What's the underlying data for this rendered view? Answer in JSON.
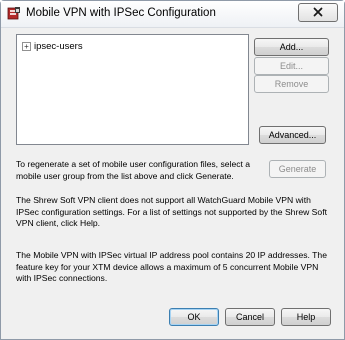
{
  "window": {
    "title": "Mobile VPN with IPSec Configuration",
    "close_label": "✕"
  },
  "tree": {
    "items": [
      {
        "label": "ipsec-users",
        "expander": "+"
      }
    ]
  },
  "buttons": {
    "add": "Add...",
    "edit": "Edit...",
    "remove": "Remove",
    "advanced": "Advanced...",
    "generate": "Generate",
    "ok": "OK",
    "cancel": "Cancel",
    "help": "Help"
  },
  "text": {
    "regenerate": "To regenerate a set of mobile user configuration files, select a mobile user group from the list above and click Generate.",
    "shrew": "The Shrew Soft VPN client does not support all WatchGuard Mobile VPN with IPSec configuration settings. For a list of settings not supported by the Shrew Soft VPN client, click Help.",
    "pool": "The Mobile VPN with IPSec virtual IP address pool contains 20 IP addresses. The feature key for your XTM device allows a maximum of 5 concurrent Mobile VPN with IPSec connections."
  },
  "colors": {
    "dialog_bg": "#f0f0f0",
    "disabled_text": "#8d8d8d",
    "default_button_border": "#3c7fb1"
  },
  "icons": {
    "app": "firebox-vpn-icon",
    "close": "close-icon",
    "expander": "plus-expander-icon"
  }
}
